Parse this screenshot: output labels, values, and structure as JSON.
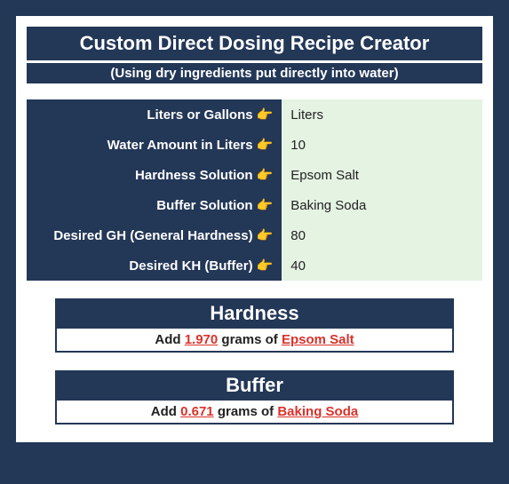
{
  "header": {
    "title": "Custom Direct Dosing Recipe Creator",
    "subtitle": "(Using dry ingredients put directly into water)"
  },
  "form": {
    "rows": [
      {
        "label": "Liters or Gallons",
        "value": "Liters"
      },
      {
        "label": "Water Amount in Liters",
        "value": "10"
      },
      {
        "label": "Hardness Solution",
        "value": "Epsom Salt"
      },
      {
        "label": "Buffer Solution",
        "value": "Baking Soda"
      },
      {
        "label": "Desired GH (General Hardness)",
        "value": "80"
      },
      {
        "label": "Desired KH (Buffer)",
        "value": "40"
      }
    ],
    "pointer": "👉"
  },
  "results": {
    "hardness": {
      "heading": "Hardness",
      "prefix": "Add ",
      "amount": "1.970",
      "mid": " grams of ",
      "ingredient": "Epsom Salt"
    },
    "buffer": {
      "heading": "Buffer",
      "prefix": "Add ",
      "amount": "0.671",
      "mid": " grams of ",
      "ingredient": "Baking Soda"
    }
  }
}
